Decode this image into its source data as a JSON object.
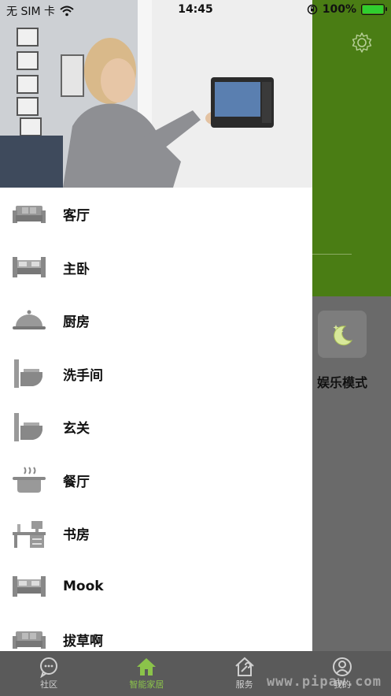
{
  "status_bar": {
    "carrier": "无 SIM 卡",
    "time": "14:45",
    "battery_percent": "100%",
    "icons": [
      "wifi-icon",
      "orientation-lock-icon",
      "battery-icon"
    ]
  },
  "background_page": {
    "mode_label": "娱乐模式",
    "icons": [
      "gear-icon",
      "moon-stars-icon"
    ],
    "colors": {
      "header_green": "#4a7d14",
      "dim_overlay": "#5f5f5f"
    }
  },
  "drawer": {
    "rooms": [
      {
        "label": "客厅",
        "icon": "sofa-icon"
      },
      {
        "label": "主卧",
        "icon": "bed-icon"
      },
      {
        "label": "厨房",
        "icon": "cloche-icon"
      },
      {
        "label": "洗手间",
        "icon": "toilet-icon"
      },
      {
        "label": "玄关",
        "icon": "toilet-icon"
      },
      {
        "label": "餐厅",
        "icon": "cooking-pot-icon"
      },
      {
        "label": "书房",
        "icon": "desk-icon"
      },
      {
        "label": "Mook",
        "icon": "bed-icon"
      },
      {
        "label": "拔草啊",
        "icon": "sofa-icon"
      }
    ]
  },
  "tabbar": {
    "tabs": [
      {
        "label": "社区",
        "icon": "chat-bubble-icon",
        "active": false
      },
      {
        "label": "智能家居",
        "icon": "home-icon",
        "active": true
      },
      {
        "label": "服务",
        "icon": "house-wrench-icon",
        "active": false
      },
      {
        "label": "我的",
        "icon": "user-icon",
        "active": false
      }
    ],
    "active_color": "#8bc34a"
  },
  "watermark": "www.pipaw.com"
}
